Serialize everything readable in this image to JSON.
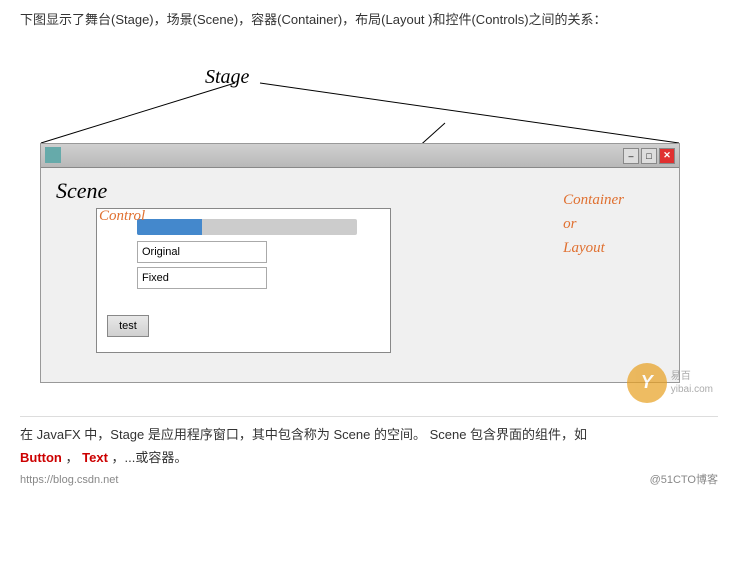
{
  "top_description": "下图显示了舞台(Stage)，场景(Scene)，容器(Container)，布局(Layout )和控件(Controls)之间的关系：",
  "diagram": {
    "stage_label": "Stage",
    "scene_label": "Scene",
    "control_label": "Control",
    "container_layout_label_line1": "Container",
    "container_layout_label_line2": "or",
    "container_layout_label_line3": "Layout",
    "progress_bar_percent": 30,
    "text_field_1": "Original",
    "text_field_2": "Fixed",
    "test_button_label": "test",
    "minimize_label": "–",
    "maximize_label": "□",
    "close_label": "✕"
  },
  "bottom_text_1": "在 JavaFX 中，Stage 是应用程序窗口，其中包含称为 Scene 的空间。   Scene 包含界面的组件，如",
  "bottom_text_2_parts": [
    "Button",
    "，",
    "Text",
    "，...或容器。"
  ],
  "bottom_url_left": "https://blog.csdn.net",
  "bottom_url_right": "@51CTO博客",
  "watermark_logo": "Y",
  "watermark_text1": "易百",
  "watermark_text2": "yibai.com"
}
